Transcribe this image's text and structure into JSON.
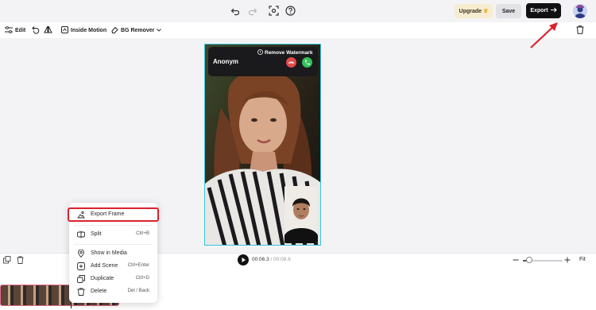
{
  "topbar": {
    "icons": [
      "undo-icon",
      "redo-icon",
      "screenshot-icon",
      "help-icon"
    ],
    "upgrade_label": "Upgrade",
    "save_label": "Save",
    "export_label": "Export",
    "export_icon": "arrow-right-icon"
  },
  "toolbar": {
    "edit_label": "Edit",
    "inside_motion_label": "Inside Motion",
    "bg_remover_label": "BG Remover"
  },
  "video": {
    "caller_name": "Anonym",
    "remove_watermark_label": "Remove Watermark"
  },
  "context_menu": {
    "items": [
      {
        "label": "Export Frame",
        "shortcut": "",
        "icon": "image-icon"
      },
      {
        "label": "Split",
        "shortcut": "Ctrl+B",
        "icon": "split-icon"
      },
      {
        "label": "Show in Media",
        "shortcut": "",
        "icon": "location-pin-icon"
      },
      {
        "label": "Add Scene",
        "shortcut": "Ctrl+Enter",
        "icon": "add-scene-icon"
      },
      {
        "label": "Duplicate",
        "shortcut": "Ctrl+D",
        "icon": "duplicate-icon"
      },
      {
        "label": "Delete",
        "shortcut": "Del / Back",
        "icon": "trash-icon"
      }
    ]
  },
  "timeline": {
    "current_time": "00:06.3",
    "separator": "/",
    "duration": "00:08.6",
    "fit_label": "Fit",
    "zoom_level": 0.15
  },
  "colors": {
    "highlight": "#d9232d",
    "selection_border": "#37c6d8",
    "export_button": "#111114"
  }
}
